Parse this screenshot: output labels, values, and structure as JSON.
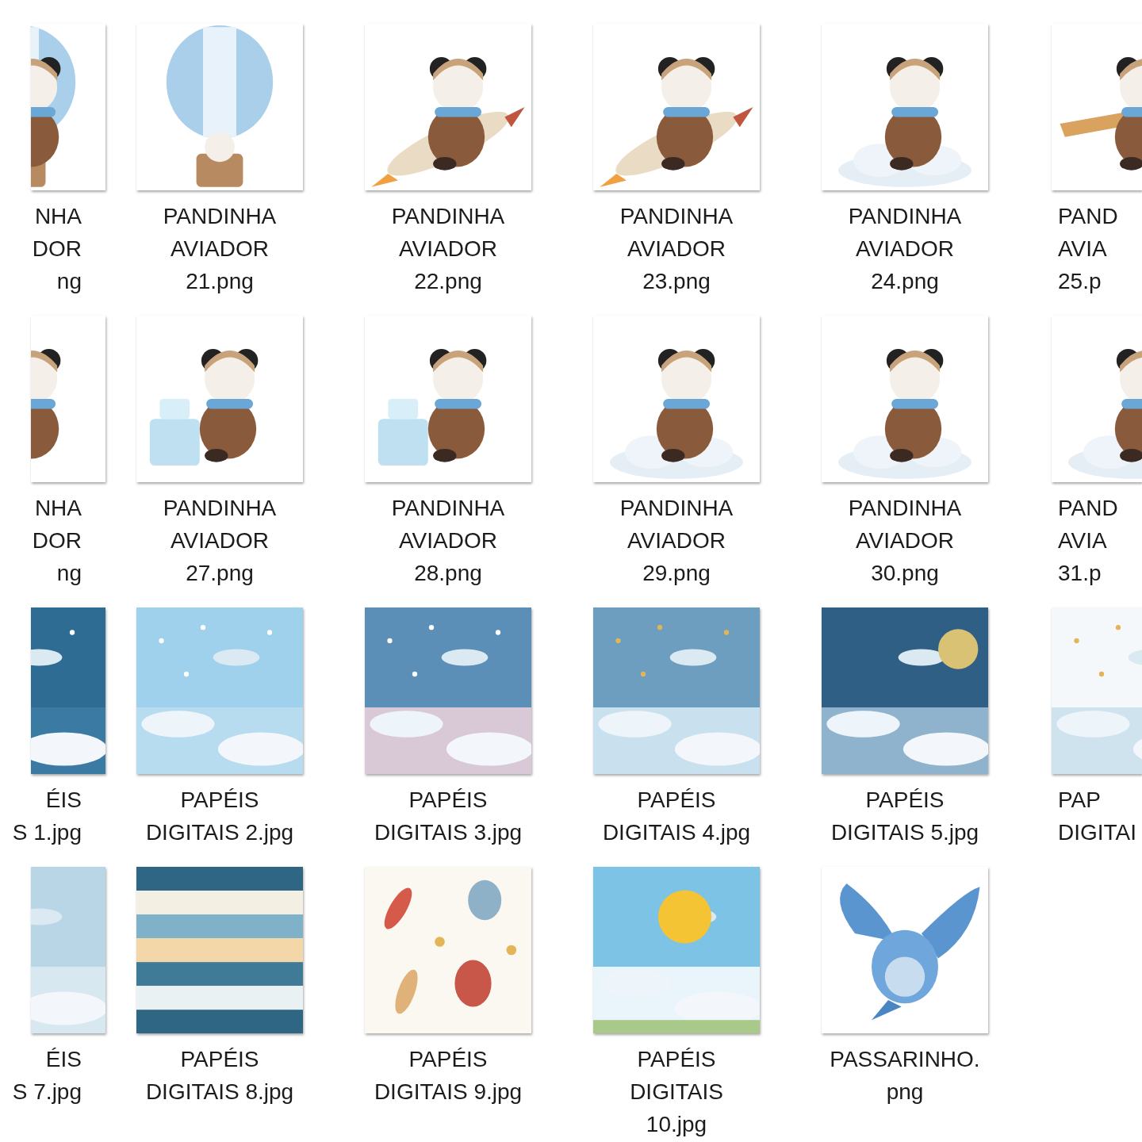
{
  "files": [
    {
      "name": "NHA\nDOR\nng"
    },
    {
      "name": "PANDINHA\nAVIADOR\n21.png"
    },
    {
      "name": "PANDINHA\nAVIADOR\n22.png"
    },
    {
      "name": "PANDINHA\nAVIADOR\n23.png"
    },
    {
      "name": "PANDINHA\nAVIADOR\n24.png"
    },
    {
      "name": "PAND\nAVIA\n25.p"
    },
    {
      "name": "NHA\nDOR\nng"
    },
    {
      "name": "PANDINHA\nAVIADOR\n27.png"
    },
    {
      "name": "PANDINHA\nAVIADOR\n28.png"
    },
    {
      "name": "PANDINHA\nAVIADOR\n29.png"
    },
    {
      "name": "PANDINHA\nAVIADOR\n30.png"
    },
    {
      "name": "PAND\nAVIA\n31.p"
    },
    {
      "name": "ÉIS\nS 1.jpg"
    },
    {
      "name": "PAPÉIS\nDIGITAIS 2.jpg"
    },
    {
      "name": "PAPÉIS\nDIGITAIS 3.jpg"
    },
    {
      "name": "PAPÉIS\nDIGITAIS 4.jpg"
    },
    {
      "name": "PAPÉIS\nDIGITAIS 5.jpg"
    },
    {
      "name": "PAP\nDIGITAI"
    },
    {
      "name": "ÉIS\nS 7.jpg"
    },
    {
      "name": "PAPÉIS\nDIGITAIS 8.jpg"
    },
    {
      "name": "PAPÉIS\nDIGITAIS 9.jpg"
    },
    {
      "name": "PAPÉIS\nDIGITAIS\n10.jpg"
    },
    {
      "name": "PASSARINHO.\npng"
    }
  ]
}
